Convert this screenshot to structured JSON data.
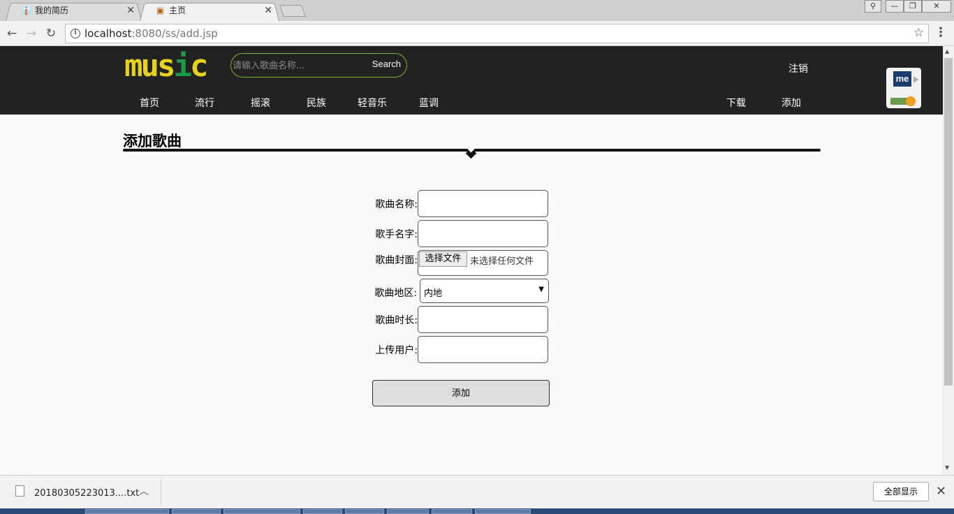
{
  "browser": {
    "tabs": [
      {
        "title": "我的简历",
        "state": "inactive",
        "icon": "resume-favicon"
      },
      {
        "title": "主页",
        "state": "active",
        "icon": "page-favicon"
      }
    ],
    "address_host": "localhost",
    "address_path": ":8080/ss/add.jsp"
  },
  "site": {
    "logo_part1": "mus",
    "logo_part2": "i",
    "logo_part3": "c",
    "search_placeholder": "请输入歌曲名称...",
    "search_button": "Search",
    "logout": "注销",
    "nav": [
      "首页",
      "流行",
      "摇滚",
      "民族",
      "轻音乐",
      "蓝调"
    ],
    "nav_right": [
      "下载",
      "添加"
    ],
    "ext_label": "me"
  },
  "form": {
    "title": "添加歌曲",
    "song_name_label": "歌曲名称:",
    "singer_label": "歌手名字:",
    "cover_label": "歌曲封面:",
    "cover_button": "选择文件",
    "cover_status": "未选择任何文件",
    "region_label": "歌曲地区:",
    "region_value": "内地",
    "duration_label": "歌曲时长:",
    "uploader_label": "上传用户:",
    "submit": "添加"
  },
  "downloads": {
    "file_name": "20180305223013....txt",
    "show_all": "全部显示"
  },
  "colors": {
    "header_bg": "#222222",
    "logo_yellow": "#e6d21a",
    "logo_green": "#1d9b4a",
    "search_border": "#7fb335"
  }
}
